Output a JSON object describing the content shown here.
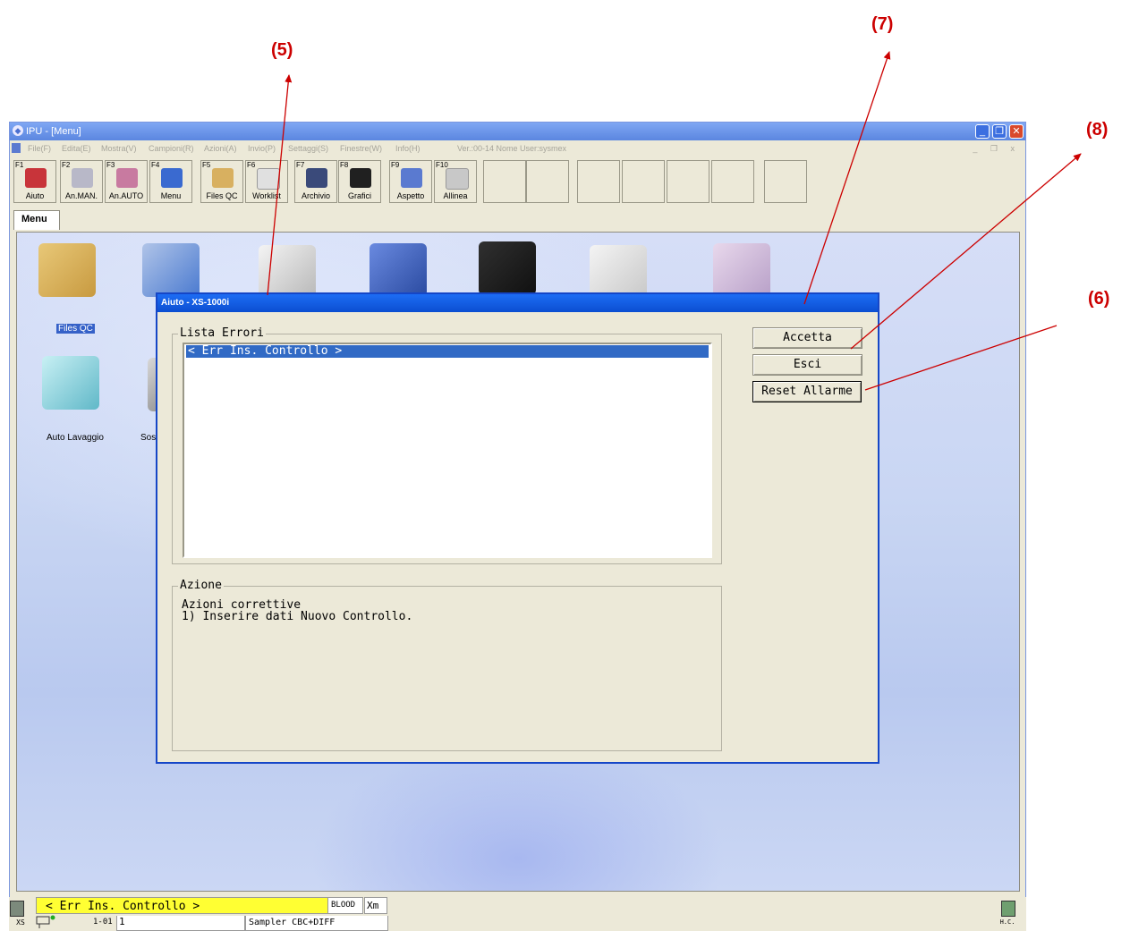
{
  "callouts": [
    "(5)",
    "(7)",
    "(8)",
    "(6)"
  ],
  "window": {
    "title": "IPU - [Menu]",
    "minimize_glyph": "_",
    "maximize_glyph": "❐",
    "close_glyph": "✕"
  },
  "menubar": {
    "items": [
      "File(F)",
      "Edita(E)",
      "Mostra(V)",
      "Campioni(R)",
      "Azioni(A)",
      "Invio(P)",
      "Settaggi(S)",
      "Finestre(W)",
      "Info(H)"
    ],
    "version": "Ver.:00-14 Nome User:sysmex",
    "mdi_controls": "_ ❐ x"
  },
  "toolbar": [
    {
      "key": "F1",
      "label": "Aiuto",
      "icon": "help-icon",
      "color": "#c8343a"
    },
    {
      "key": "F2",
      "label": "An.MAN.",
      "icon": "manual-analysis-icon",
      "color": "#b8b8c8"
    },
    {
      "key": "F3",
      "label": "An.AUTO",
      "icon": "auto-analysis-icon",
      "color": "#c87aa0"
    },
    {
      "key": "F4",
      "label": "Menu",
      "icon": "menu-icon",
      "color": "#3a6ad0"
    },
    {
      "key": "F5",
      "label": "Files QC",
      "icon": "qc-files-icon",
      "color": "#d8b060"
    },
    {
      "key": "F6",
      "label": "Worklist",
      "icon": "worklist-icon",
      "color": "#e8e8e8"
    },
    {
      "key": "F7",
      "label": "Archivio",
      "icon": "archive-icon",
      "color": "#3a4a7a"
    },
    {
      "key": "F8",
      "label": "Grafici",
      "icon": "graphics-icon",
      "color": "#202020"
    },
    {
      "key": "F9",
      "label": "Aspetto",
      "icon": "appearance-icon",
      "color": "#5a7ad0"
    },
    {
      "key": "F10",
      "label": "Allinea",
      "icon": "align-icon",
      "color": "#c8c8c8"
    }
  ],
  "tab": {
    "label": "Menu"
  },
  "desktop": {
    "icons": [
      {
        "name": "qc-files-folder-icon",
        "color": "#d8b060"
      },
      {
        "name": "qc-chart-globe-icon",
        "color": "#6a9ad8"
      },
      {
        "name": "documents-icon",
        "color": "#e8e8e8"
      },
      {
        "name": "clipboard-magnifier-icon",
        "color": "#3a5ac0"
      },
      {
        "name": "scattergram-magnifier-icon",
        "color": "#202020"
      },
      {
        "name": "reagent-hand-icon",
        "color": "#e0e0e0"
      },
      {
        "name": "sample-tubes-icon",
        "color": "#d0b8d8"
      },
      {
        "name": "auto-wash-gloves-icon",
        "color": "#8ad0d8"
      },
      {
        "name": "replace-item-icon",
        "color": "#b0b0b0"
      }
    ],
    "labels": {
      "files_qc": "Files QC",
      "auto_wash": "Auto Lavaggio",
      "replace": "Sos"
    }
  },
  "dialog": {
    "title": "Aiuto - XS-1000i",
    "error_list_caption": "Lista Errori",
    "error_items": [
      "< Err Ins. Controllo >"
    ],
    "action_caption": "Azione",
    "action_text": "Azioni correttive\n1) Inserire dati Nuovo Controllo.",
    "buttons": {
      "accept": "Accetta",
      "exit": "Esci",
      "reset_alarm": "Reset Allarme"
    }
  },
  "statusbar": {
    "error": "< Err Ins. Controllo >",
    "sample_type": "BLOOD",
    "mode": "Xm",
    "left_label": "XS",
    "rack_pos": "1-01",
    "tube": "1",
    "sampler": "Sampler CBC+DIFF",
    "right_label": "H.C."
  },
  "colors": {
    "callout": "#cc0000",
    "titlebar": "#1d6df4",
    "selection": "#316ac5",
    "status_error": "#ffff33"
  }
}
